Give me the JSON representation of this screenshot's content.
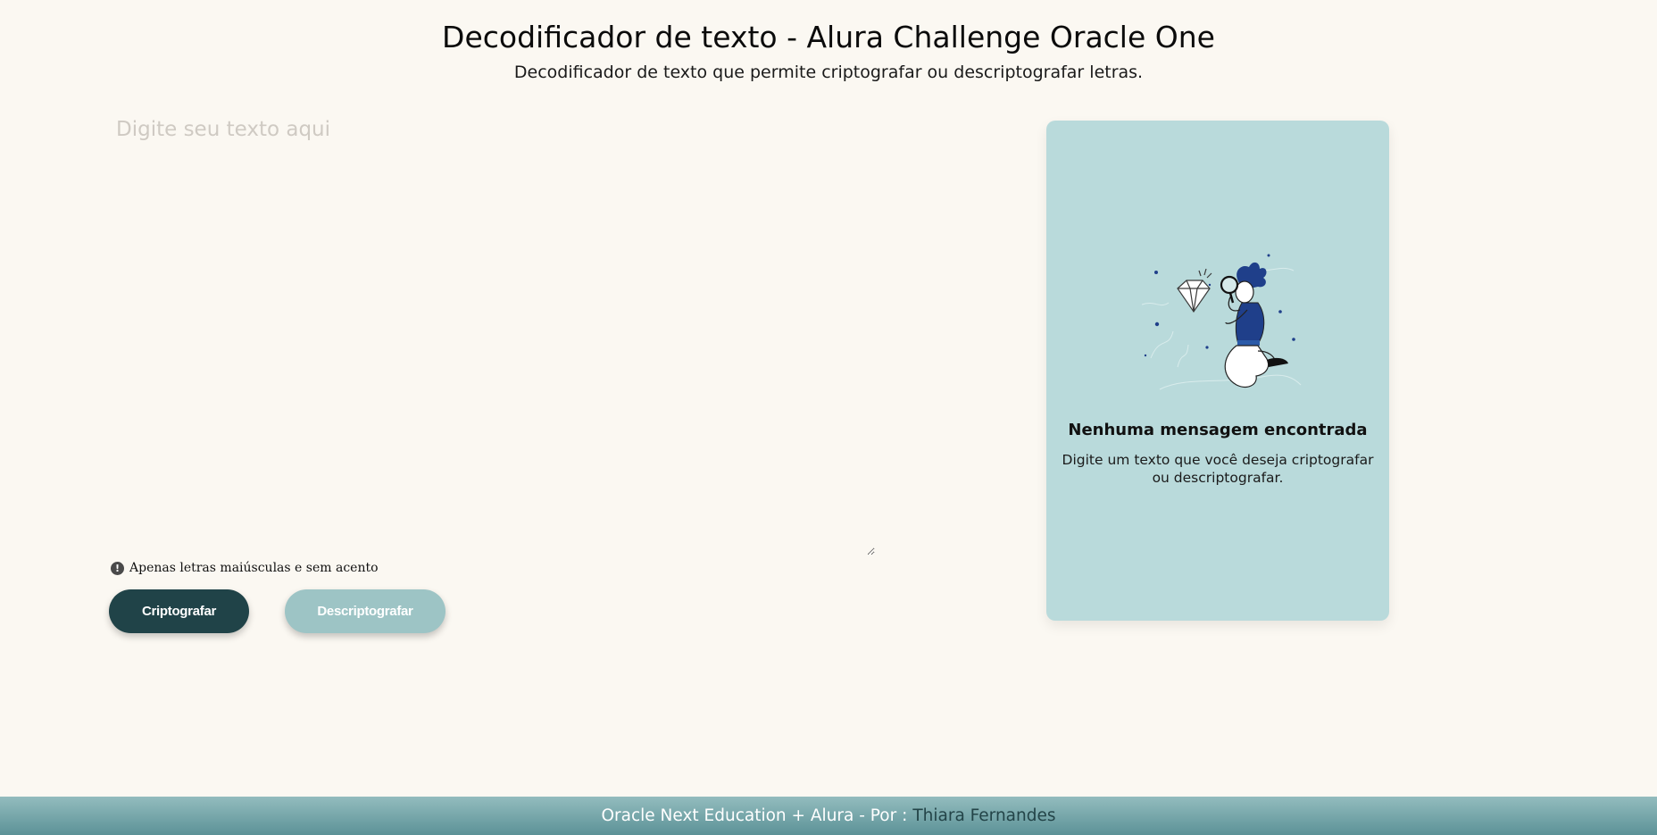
{
  "header": {
    "title": "Decodificador de texto - Alura Challenge Oracle One",
    "subtitle": "Decodificador de texto que permite criptografar ou descriptografar letras."
  },
  "input": {
    "value": "",
    "placeholder": "Digite seu texto aqui"
  },
  "hint": {
    "icon": "exclamation-circle-icon",
    "icon_glyph": "!",
    "text": "Apenas letras maiúsculas e sem acento"
  },
  "buttons": {
    "encrypt_label": "Criptografar",
    "decrypt_label": "Descriptografar"
  },
  "result_panel": {
    "illustration": "person-with-magnifier-and-diamond-illustration",
    "title": "Nenhuma mensagem encontrada",
    "text": "Digite um texto que você deseja criptografar ou descriptografar."
  },
  "footer": {
    "text": "Oracle Next Education + Alura - Por :",
    "author": "Thiara Fernandes"
  },
  "colors": {
    "background": "#fbf8f2",
    "primary_button": "#204348",
    "secondary_button": "#9dc4c5",
    "panel": "#b9dadb",
    "footer_top": "#93bcbe",
    "footer_bottom": "#5c9297"
  }
}
